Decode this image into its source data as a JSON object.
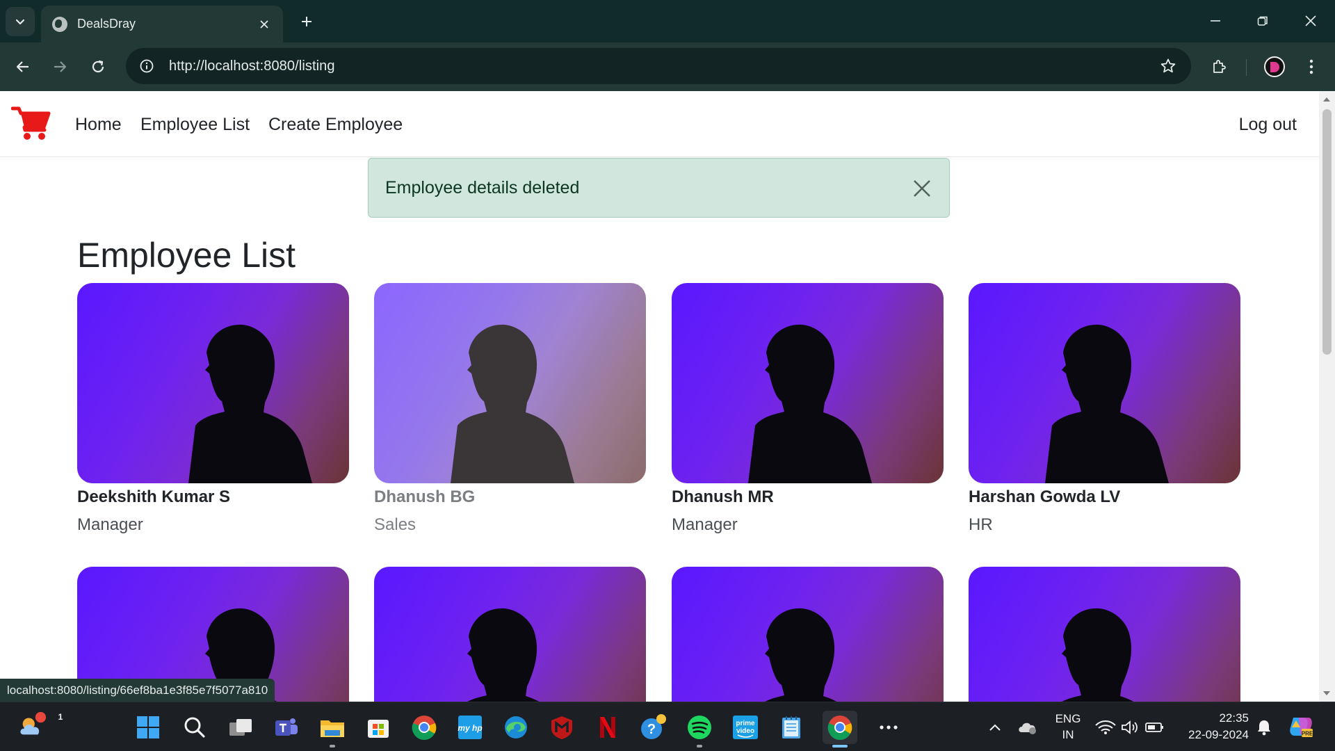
{
  "browser": {
    "tab_title": "DealsDray",
    "url": "http://localhost:8080/listing",
    "status_url": "localhost:8080/listing/66ef8ba1e3f85e7f5077a810"
  },
  "navbar": {
    "links": [
      "Home",
      "Employee List",
      "Create Employee"
    ],
    "logout": "Log out",
    "logo_color": "#e81919"
  },
  "alert": {
    "message": "Employee details deleted",
    "bg_color": "#d1e7dd"
  },
  "page": {
    "title": "Employee List"
  },
  "employees": [
    {
      "name": "Deekshith Kumar S",
      "role": "Manager"
    },
    {
      "name": "Dhanush BG",
      "role": "Sales"
    },
    {
      "name": "Dhanush MR",
      "role": "Manager"
    },
    {
      "name": "Harshan Gowda LV",
      "role": "HR"
    }
  ],
  "taskbar": {
    "weather_badge": "1",
    "lang_top": "ENG",
    "lang_bottom": "IN",
    "time": "22:35",
    "date": "22-09-2024",
    "apps": [
      "start-icon",
      "search-icon",
      "task-view-icon",
      "teams-icon",
      "file-explorer-icon",
      "store-icon",
      "chrome-icon",
      "myhp-icon",
      "edge-icon",
      "mcafee-icon",
      "netflix-icon",
      "help-icon",
      "spotify-icon",
      "prime-video-icon",
      "notepad-icon",
      "chrome-active-icon",
      "more-icon"
    ]
  }
}
